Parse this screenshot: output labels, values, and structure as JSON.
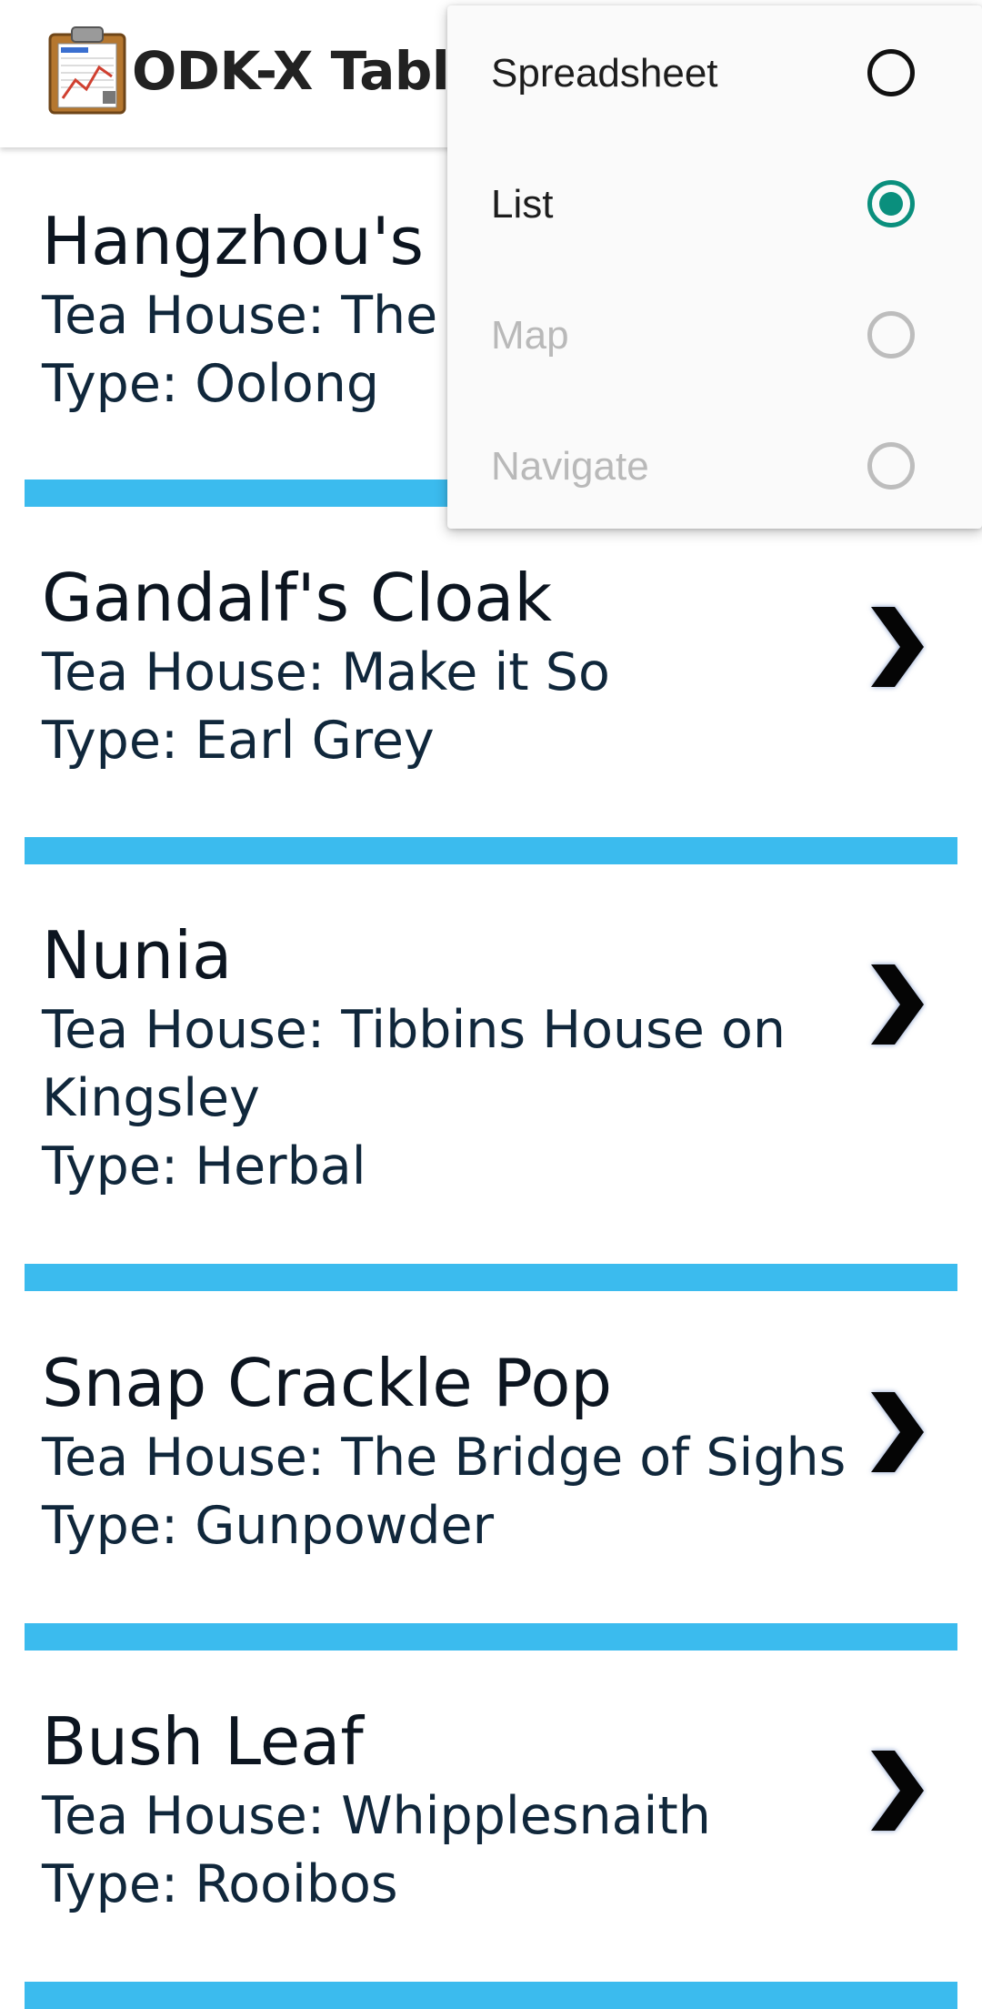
{
  "app": {
    "title": "ODK-X Tabl...",
    "icon": "clipboard-chart-icon"
  },
  "colors": {
    "divider": "#3bbbee",
    "radio_checked": "#0a8f7d",
    "disabled_text": "#b9b9b9"
  },
  "items": [
    {
      "name": "Hangzhou's",
      "tea_house": "Tea House: The",
      "type": "Type: Oolong"
    },
    {
      "name": "Gandalf's Cloak",
      "tea_house": "Tea House: Make it So",
      "type": "Type: Earl Grey"
    },
    {
      "name": "Nunia",
      "tea_house": "Tea House: Tibbins House on",
      "tea_house_cont": "Kingsley",
      "type": "Type: Herbal"
    },
    {
      "name": "Snap Crackle Pop",
      "tea_house": "Tea House: The Bridge of Sighs",
      "type": "Type: Gunpowder"
    },
    {
      "name": "Bush Leaf",
      "tea_house": "Tea House: Whipplesnaith",
      "type": "Type: Rooibos"
    }
  ],
  "menu": {
    "options": [
      {
        "label": "Spreadsheet",
        "selected": false,
        "enabled": true
      },
      {
        "label": "List",
        "selected": true,
        "enabled": true
      },
      {
        "label": "Map",
        "selected": false,
        "enabled": false
      },
      {
        "label": "Navigate",
        "selected": false,
        "enabled": false
      }
    ]
  }
}
